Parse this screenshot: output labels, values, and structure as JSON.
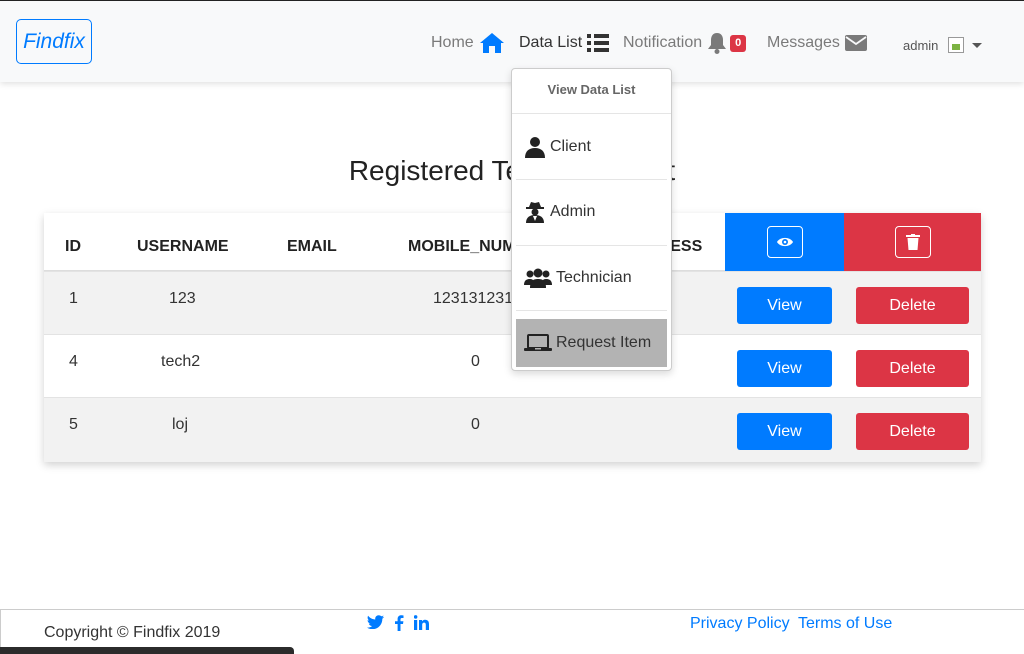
{
  "navbar": {
    "brand": "Findfix",
    "home": "Home",
    "data_list": "Data List",
    "notification": "Notification",
    "notification_count": "0",
    "messages": "Messages",
    "user": "admin",
    "icons": [
      "home-icon",
      "list-icon",
      "bell-icon",
      "envelope-icon",
      "avatar",
      "caret-down-icon"
    ]
  },
  "page": {
    "title": "Registered Technician List"
  },
  "table": {
    "columns": [
      "ID",
      "USERNAME",
      "EMAIL",
      "MOBILE_NUMBER",
      "ADDRESS"
    ],
    "rows": [
      {
        "id": "1",
        "username": "123",
        "email": "",
        "mobile": "123131231",
        "address": ""
      },
      {
        "id": "4",
        "username": "tech2",
        "email": "",
        "mobile": "0",
        "address": ""
      },
      {
        "id": "5",
        "username": "loj",
        "email": "",
        "mobile": "0",
        "address": ""
      }
    ],
    "view_label": "View",
    "delete_label": "Delete"
  },
  "dropdown": {
    "header": "View Data List",
    "items": [
      {
        "label": "Client",
        "icon": "user-icon"
      },
      {
        "label": "Admin",
        "icon": "user-secret-icon"
      },
      {
        "label": "Technician",
        "icon": "users-icon"
      },
      {
        "label": "Request Item",
        "icon": "laptop-icon"
      }
    ]
  },
  "footer": {
    "copyright": "Copyright © Findfix 2019",
    "social": [
      "twitter-icon",
      "facebook-icon",
      "linkedin-icon"
    ],
    "privacy": "Privacy Policy",
    "terms": "Terms of Use"
  },
  "colors": {
    "primary": "#007bff",
    "danger": "#dc3545",
    "navbar_bg": "#f8f9fa"
  }
}
